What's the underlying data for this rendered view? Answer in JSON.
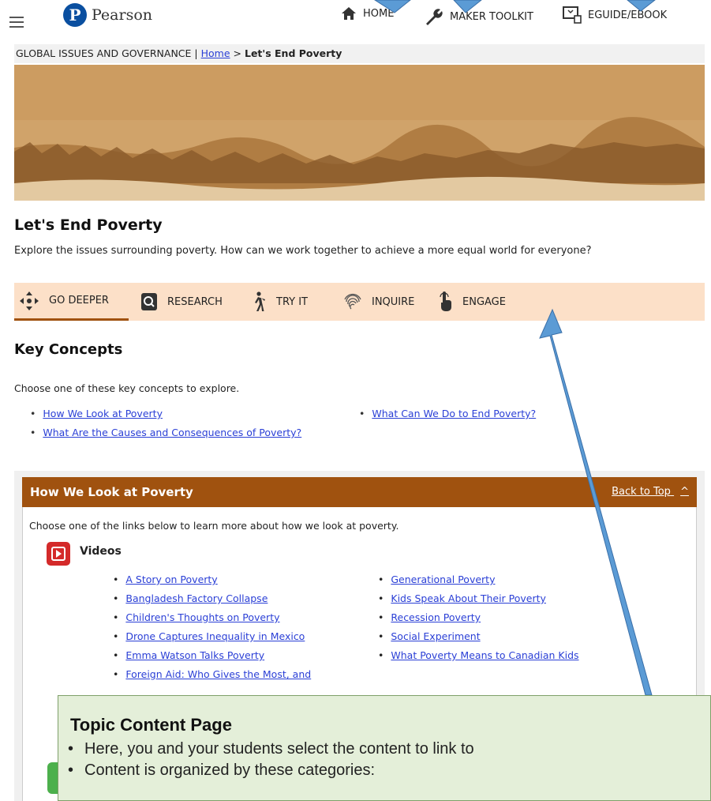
{
  "header": {
    "logo_letter": "P",
    "logo_text": "Pearson",
    "nav": {
      "home": "HOME",
      "maker_toolkit": "MAKER TOOLKIT",
      "eguide": "EGUIDE/EBOOK"
    }
  },
  "breadcrumb": {
    "section": "GLOBAL ISSUES AND GOVERNANCE |",
    "home_link": "Home",
    "separator": ">",
    "current": "Let's End Poverty"
  },
  "page": {
    "title": "Let's End Poverty",
    "intro": "Explore the issues surrounding poverty. How can we work together to achieve a more equal world for everyone?"
  },
  "tabs": [
    {
      "label": "GO DEEPER",
      "icon": "move-icon"
    },
    {
      "label": "RESEARCH",
      "icon": "magnifier-doc-icon"
    },
    {
      "label": "TRY IT",
      "icon": "walking-person-icon"
    },
    {
      "label": "INQUIRE",
      "icon": "fingerprint-icon"
    },
    {
      "label": "ENGAGE",
      "icon": "pointing-hand-icon"
    }
  ],
  "key_concepts": {
    "title": "Key Concepts",
    "intro": "Choose one of these key concepts to explore.",
    "items": [
      "How We Look at Poverty",
      "What Are the Causes and Consequences of Poverty?",
      "What Can We Do to End Poverty?"
    ]
  },
  "section": {
    "title": "How We Look at Poverty",
    "back_to_top": "Back to Top",
    "intro": "Choose one of the links below to learn more about how we look at poverty.",
    "videos_title": "Videos",
    "videos_left": [
      "A Story on Poverty",
      "Bangladesh Factory Collapse",
      "Children's Thoughts on Poverty",
      "Drone Captures Inequality in Mexico",
      "Emma Watson Talks Poverty",
      "Foreign Aid: Who Gives the Most, and"
    ],
    "videos_right": [
      "Generational Poverty",
      "Kids Speak About Their Poverty",
      "Recession Poverty",
      "Social Experiment",
      "What Poverty Means to Canadian Kids"
    ]
  },
  "callout": {
    "title": "Topic Content Page",
    "bullets": [
      "Here, you and your students select the content to link to",
      "Content is organized by these categories:"
    ]
  },
  "colors": {
    "brand_blue": "#0a4fa0",
    "section_header": "#a0520f",
    "tab_bar": "#fce0c8",
    "callout_bg": "#e4efd9",
    "arrow": "#5b9bd5"
  }
}
